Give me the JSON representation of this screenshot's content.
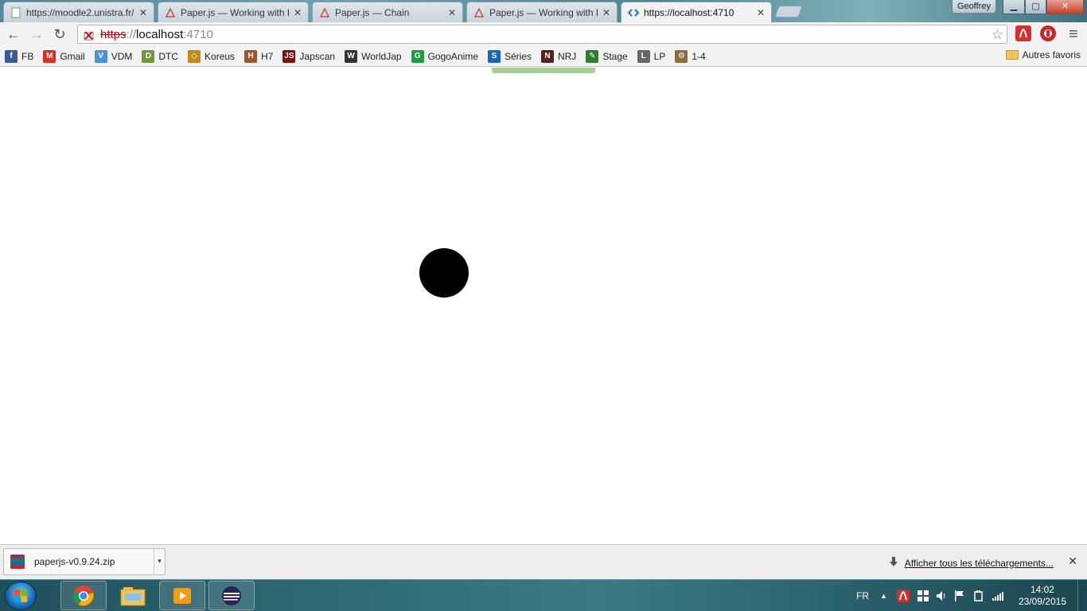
{
  "window": {
    "user": "Geoffrey",
    "min_symbol": "▁",
    "max_symbol": "▢",
    "close_symbol": "✕"
  },
  "tabs": [
    {
      "title": "https://moodle2.unistra.fr/",
      "active": false
    },
    {
      "title": "Paper.js — Working with P",
      "active": false
    },
    {
      "title": "Paper.js — Chain",
      "active": false
    },
    {
      "title": "Paper.js — Working with P",
      "active": false
    },
    {
      "title": "https://localhost:4710",
      "active": true
    }
  ],
  "tab_close_symbol": "✕",
  "toolbar": {
    "back": "←",
    "forward": "→",
    "reload": "↻",
    "menu": "≡",
    "star": "☆"
  },
  "address": {
    "scheme": "https",
    "separator": "://",
    "host": "localhost",
    "port": ":4710"
  },
  "bookmarks": [
    {
      "label": "FB",
      "icon": "facebook-icon",
      "glyph": "f",
      "color": "#3b5998"
    },
    {
      "label": "Gmail",
      "icon": "gmail-icon",
      "glyph": "M",
      "color": "#d93025"
    },
    {
      "label": "VDM",
      "icon": "vdm-icon",
      "glyph": "V",
      "color": "#4a90d9"
    },
    {
      "label": "DTC",
      "icon": "dtc-icon",
      "glyph": "D",
      "color": "#6a9a3a"
    },
    {
      "label": "Koreus",
      "icon": "koreus-icon",
      "glyph": "◇",
      "color": "#c28a1a"
    },
    {
      "label": "H7",
      "icon": "h7-icon",
      "glyph": "H",
      "color": "#a0522d"
    },
    {
      "label": "Japscan",
      "icon": "japscan-icon",
      "glyph": "JS",
      "color": "#7a1010"
    },
    {
      "label": "WorldJap",
      "icon": "worldjap-icon",
      "glyph": "W",
      "color": "#333333"
    },
    {
      "label": "GogoAnime",
      "icon": "gogoanime-icon",
      "glyph": "G",
      "color": "#1e9e3e"
    },
    {
      "label": "Séries",
      "icon": "series-icon",
      "glyph": "S",
      "color": "#1565c0"
    },
    {
      "label": "NRJ",
      "icon": "nrj-icon",
      "glyph": "N",
      "color": "#552222"
    },
    {
      "label": "Stage",
      "icon": "stage-icon",
      "glyph": "✎",
      "color": "#2e7d32"
    },
    {
      "label": "LP",
      "icon": "lp-icon",
      "glyph": "L",
      "color": "#666666"
    },
    {
      "label": "1-4",
      "icon": "one-four-icon",
      "glyph": "⚙",
      "color": "#8a6d3b"
    }
  ],
  "bookmarks_other": "Autres favoris",
  "download": {
    "filename": "paperjs-v0.9.24.zip",
    "caret": "▾",
    "show_all": "Afficher tous les téléchargements...",
    "close": "✕"
  },
  "taskbar": {
    "language": "FR",
    "time": "14:02",
    "date": "23/09/2015",
    "apps": [
      "chrome-icon",
      "explorer-icon",
      "media-player-icon",
      "eclipse-icon"
    ],
    "tray_arrow": "▲"
  },
  "colors": {
    "page_bg": "#ffffff",
    "ball": "#000000",
    "green_bar": "#a8d08d",
    "insecure_scheme": "#cc0000"
  }
}
